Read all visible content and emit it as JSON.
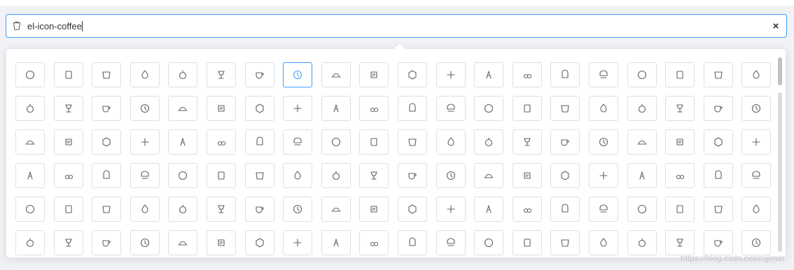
{
  "input": {
    "value": "el-icon-coffee",
    "prefix_icon": "coffee-cup-icon",
    "clear_label": "×"
  },
  "icon_picker": {
    "selected_index": 7,
    "accent_color": "#409eff",
    "icons": [
      "ice-cream-round",
      "ice-cream-square",
      "lollipop",
      "potato-strips",
      "milk-tea",
      "ice-drink",
      "ice-tea",
      "coffee",
      "orange",
      "pear",
      "apple",
      "cherry",
      "watermelon",
      "grape",
      "refrigerator",
      "goblet-square-full",
      "goblet-square",
      "goblet-full",
      "goblet",
      "cold-drink",
      "coffee-cup",
      "water-cup",
      "hot-water",
      "ice-cream",
      "dessert",
      "sugar",
      "tableware",
      "burger",
      "knife-fork",
      "fork-spoon",
      "chicken",
      "food",
      "dish-1",
      "dish",
      "moon-night",
      "moon",
      "cloudy-and-sunny",
      "partly-cloudy",
      "cloudy",
      "sunny",
      "sunset",
      "sunrise-1",
      "sunrise",
      "heavy-rain",
      "lightning",
      "light-rain",
      "wind-power",
      "baseball",
      "soccer",
      "football",
      "basketball",
      "ship",
      "truck",
      "bicycle",
      "mobile-phone",
      "service",
      "key",
      "unlock",
      "lock",
      "watch",
      "watch-1",
      "timer",
      "alarm-clock",
      "map-location",
      "delete-location",
      "add-location",
      "location-information",
      "location-outline",
      "location",
      "place",
      "discover",
      "first-aid-kit",
      "trophy-1",
      "trophy",
      "medal",
      "medal-1",
      "stopwatch",
      "mic",
      "copy-document",
      "full-screen",
      "switch-button",
      "aim",
      "crop",
      "odometer",
      "time",
      "bangzhu",
      "close-notification",
      "microphone",
      "turn-off-microphone",
      "position",
      "postcard",
      "message",
      "chat-line-square",
      "chat-dot-square",
      "chat-dot-round",
      "chat-square",
      "chat-line-round",
      "chat-round",
      "set-up",
      "turn-off",
      "open",
      "connection",
      "link",
      "cpu",
      "thumb",
      "female",
      "male",
      "guide",
      "news",
      "price-tag",
      "discount",
      "wallet",
      "coin",
      "money",
      "bank-card",
      "box",
      "present",
      "sell",
      "sold-out",
      "shopping-bag-2"
    ]
  },
  "watermark": "https://blog.csdn.net/mjjimin"
}
